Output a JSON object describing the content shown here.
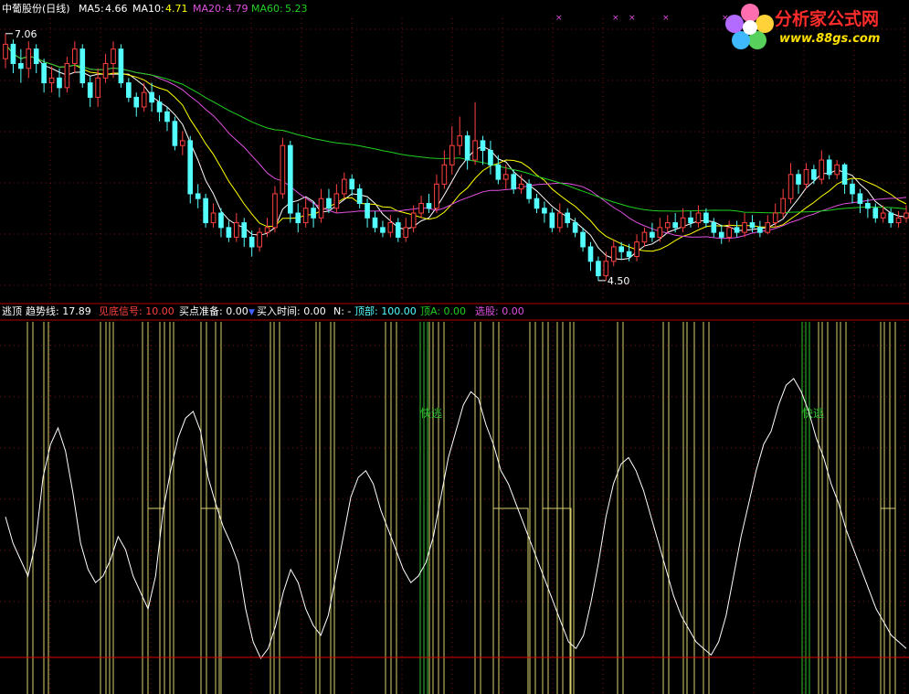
{
  "colors": {
    "background": "#000000",
    "grid": "#7a1010",
    "up": "#ff4040",
    "down": "#54ffff",
    "ma5": "#ffffff",
    "ma10": "#ffff00",
    "ma20": "#e050e0",
    "ma60": "#20d020",
    "trend": "#ffffff",
    "signal_yellow": "#d8d070",
    "signal_green": "#30c030",
    "baseline": "#e00000"
  },
  "header": {
    "stock": "中葡股份(日线)",
    "ma5_label": "MA5:",
    "ma5_value": "4.66",
    "ma10_label": "MA10:",
    "ma10_value": "4.71",
    "ma20_label": "MA20:",
    "ma20_value": "4.79",
    "ma60_label": "MA60:",
    "ma60_value": "5.23"
  },
  "logo": {
    "title": "分析家公式网",
    "url": "www.88gs.com"
  },
  "indicator": {
    "name": "逃顶",
    "items": [
      {
        "label": "趋势线:",
        "value": "17.89",
        "color": "#ffffff"
      },
      {
        "label": "见底信号:",
        "value": "10.00",
        "color": "#ff4040"
      },
      {
        "label": "买点准备:",
        "value": "0.00",
        "color": "#ffffff"
      },
      {
        "label": "买入时间:",
        "value": "0.00",
        "color": "#ffffff"
      },
      {
        "label": "N:",
        "value": "-",
        "color": "#ffffff"
      },
      {
        "label": "顶部:",
        "value": "100.00",
        "color": "#54ffff"
      },
      {
        "label": "顶A:",
        "value": "0.00",
        "color": "#20d020"
      },
      {
        "label": "选股:",
        "value": "0.00",
        "color": "#e050e0"
      }
    ],
    "signal_text": "快逃"
  },
  "chart_data": [
    {
      "type": "candlestick",
      "title": "中葡股份(日线)",
      "high_label": "7.06",
      "low_label": "4.50",
      "ylim": [
        4.3,
        7.2
      ],
      "candles": [
        [
          6.8,
          6.95,
          7.06,
          6.7
        ],
        [
          6.95,
          6.75,
          7.0,
          6.65
        ],
        [
          6.75,
          6.7,
          6.9,
          6.55
        ],
        [
          6.7,
          6.9,
          6.98,
          6.6
        ],
        [
          6.9,
          6.75,
          6.95,
          6.65
        ],
        [
          6.75,
          6.55,
          6.8,
          6.45
        ],
        [
          6.55,
          6.6,
          6.72,
          6.45
        ],
        [
          6.6,
          6.5,
          6.7,
          6.4
        ],
        [
          6.5,
          6.75,
          6.82,
          6.45
        ],
        [
          6.75,
          6.9,
          6.98,
          6.65
        ],
        [
          6.9,
          6.55,
          6.95,
          6.5
        ],
        [
          6.55,
          6.4,
          6.62,
          6.3
        ],
        [
          6.4,
          6.6,
          6.7,
          6.3
        ],
        [
          6.6,
          6.75,
          6.85,
          6.55
        ],
        [
          6.75,
          6.9,
          6.98,
          6.6
        ],
        [
          6.9,
          6.55,
          6.95,
          6.5
        ],
        [
          6.55,
          6.4,
          6.6,
          6.35
        ],
        [
          6.4,
          6.3,
          6.45,
          6.2
        ],
        [
          6.3,
          6.45,
          6.55,
          6.25
        ],
        [
          6.45,
          6.35,
          6.55,
          6.25
        ],
        [
          6.35,
          6.25,
          6.42,
          6.15
        ],
        [
          6.25,
          6.15,
          6.3,
          6.05
        ],
        [
          6.15,
          5.9,
          6.2,
          5.85
        ],
        [
          5.9,
          5.95,
          6.05,
          5.8
        ],
        [
          5.95,
          5.4,
          6.0,
          5.3
        ],
        [
          5.4,
          5.35,
          5.5,
          5.25
        ],
        [
          5.35,
          5.1,
          5.4,
          5.05
        ],
        [
          5.1,
          5.2,
          5.3,
          5.05
        ],
        [
          5.2,
          5.05,
          5.25,
          4.95
        ],
        [
          5.05,
          4.95,
          5.12,
          4.9
        ],
        [
          4.95,
          5.1,
          5.2,
          4.9
        ],
        [
          5.1,
          4.95,
          5.15,
          4.85
        ],
        [
          4.95,
          4.85,
          5.02,
          4.75
        ],
        [
          4.85,
          5.0,
          5.05,
          4.8
        ],
        [
          5.0,
          5.05,
          5.15,
          4.95
        ],
        [
          5.05,
          5.4,
          5.48,
          5.0
        ],
        [
          5.4,
          5.9,
          5.98,
          5.35
        ],
        [
          5.9,
          5.2,
          5.95,
          5.1
        ],
        [
          5.2,
          5.1,
          5.3,
          5.0
        ],
        [
          5.1,
          5.25,
          5.35,
          5.05
        ],
        [
          5.25,
          5.15,
          5.32,
          5.05
        ],
        [
          5.15,
          5.35,
          5.45,
          5.1
        ],
        [
          5.35,
          5.25,
          5.45,
          5.2
        ],
        [
          5.25,
          5.4,
          5.5,
          5.2
        ],
        [
          5.4,
          5.55,
          5.62,
          5.35
        ],
        [
          5.55,
          5.45,
          5.6,
          5.38
        ],
        [
          5.45,
          5.3,
          5.5,
          5.25
        ],
        [
          5.3,
          5.15,
          5.35,
          5.05
        ],
        [
          5.15,
          5.05,
          5.22,
          5.0
        ],
        [
          5.05,
          5.0,
          5.12,
          4.95
        ],
        [
          5.0,
          5.1,
          5.18,
          4.95
        ],
        [
          5.1,
          4.95,
          5.15,
          4.9
        ],
        [
          4.95,
          5.05,
          5.15,
          4.9
        ],
        [
          5.05,
          5.2,
          5.28,
          5.0
        ],
        [
          5.2,
          5.3,
          5.38,
          5.15
        ],
        [
          5.3,
          5.25,
          5.4,
          5.2
        ],
        [
          5.25,
          5.5,
          5.6,
          5.2
        ],
        [
          5.5,
          5.7,
          5.85,
          5.45
        ],
        [
          5.7,
          5.9,
          6.1,
          5.6
        ],
        [
          5.9,
          6.0,
          6.2,
          5.8
        ],
        [
          6.0,
          5.75,
          6.05,
          5.65
        ],
        [
          5.75,
          5.95,
          6.35,
          5.7
        ],
        [
          5.95,
          5.85,
          6.0,
          5.7
        ],
        [
          5.85,
          5.7,
          5.95,
          5.6
        ],
        [
          5.7,
          5.55,
          5.8,
          5.5
        ],
        [
          5.55,
          5.6,
          5.7,
          5.45
        ],
        [
          5.6,
          5.45,
          5.65,
          5.4
        ],
        [
          5.45,
          5.5,
          5.6,
          5.4
        ],
        [
          5.5,
          5.35,
          5.55,
          5.3
        ],
        [
          5.35,
          5.25,
          5.4,
          5.2
        ],
        [
          5.25,
          5.2,
          5.32,
          5.1
        ],
        [
          5.2,
          5.05,
          5.25,
          5.0
        ],
        [
          5.05,
          5.2,
          5.3,
          5.0
        ],
        [
          5.2,
          5.1,
          5.25,
          5.05
        ],
        [
          5.1,
          5.0,
          5.15,
          4.95
        ],
        [
          5.0,
          4.85,
          5.05,
          4.8
        ],
        [
          4.85,
          4.7,
          4.9,
          4.6
        ],
        [
          4.7,
          4.55,
          4.75,
          4.5
        ],
        [
          4.55,
          4.7,
          4.8,
          4.5
        ],
        [
          4.7,
          4.85,
          4.92,
          4.65
        ],
        [
          4.85,
          4.8,
          4.9,
          4.72
        ],
        [
          4.8,
          4.75,
          4.88,
          4.7
        ],
        [
          4.75,
          4.9,
          4.98,
          4.7
        ],
        [
          4.9,
          5.0,
          5.05,
          4.85
        ],
        [
          5.0,
          4.95,
          5.1,
          4.9
        ],
        [
          4.95,
          5.05,
          5.15,
          4.9
        ],
        [
          5.05,
          5.1,
          5.18,
          5.0
        ],
        [
          5.1,
          5.05,
          5.2,
          5.0
        ],
        [
          5.05,
          5.15,
          5.25,
          5.0
        ],
        [
          5.15,
          5.1,
          5.22,
          5.05
        ],
        [
          5.1,
          5.2,
          5.28,
          5.05
        ],
        [
          5.2,
          5.1,
          5.25,
          5.05
        ],
        [
          5.1,
          5.0,
          5.15,
          4.95
        ],
        [
          5.0,
          4.95,
          5.08,
          4.88
        ],
        [
          4.95,
          5.05,
          5.12,
          4.9
        ],
        [
          5.05,
          5.0,
          5.12,
          4.95
        ],
        [
          5.0,
          5.1,
          5.2,
          4.95
        ],
        [
          5.1,
          5.05,
          5.18,
          5.0
        ],
        [
          5.05,
          5.0,
          5.12,
          4.95
        ],
        [
          5.0,
          5.1,
          5.18,
          4.98
        ],
        [
          5.1,
          5.2,
          5.3,
          5.05
        ],
        [
          5.2,
          5.35,
          5.45,
          5.15
        ],
        [
          5.35,
          5.6,
          5.72,
          5.3
        ],
        [
          5.6,
          5.5,
          5.65,
          5.4
        ],
        [
          5.5,
          5.65,
          5.72,
          5.45
        ],
        [
          5.65,
          5.55,
          5.7,
          5.5
        ],
        [
          5.55,
          5.75,
          5.85,
          5.5
        ],
        [
          5.75,
          5.6,
          5.8,
          5.55
        ],
        [
          5.6,
          5.7,
          5.75,
          5.55
        ],
        [
          5.7,
          5.5,
          5.72,
          5.4
        ],
        [
          5.5,
          5.4,
          5.55,
          5.3
        ],
        [
          5.4,
          5.3,
          5.45,
          5.2
        ],
        [
          5.3,
          5.25,
          5.35,
          5.15
        ],
        [
          5.25,
          5.15,
          5.3,
          5.1
        ],
        [
          5.15,
          5.2,
          5.28,
          5.1
        ],
        [
          5.2,
          5.1,
          5.25,
          5.05
        ],
        [
          5.1,
          5.15,
          5.22,
          5.05
        ],
        [
          5.15,
          5.2,
          5.28,
          5.1
        ]
      ],
      "ma_series": [
        {
          "name": "MA5",
          "value": "4.66"
        },
        {
          "name": "MA10",
          "value": "4.71"
        },
        {
          "name": "MA20",
          "value": "4.79"
        },
        {
          "name": "MA60",
          "value": "5.23"
        }
      ]
    },
    {
      "type": "line",
      "title": "逃顶",
      "ylim": [
        -5,
        105
      ],
      "series": [
        {
          "name": "趋势线",
          "values": [
            48,
            40,
            35,
            30,
            40,
            60,
            70,
            75,
            68,
            55,
            40,
            32,
            28,
            30,
            35,
            42,
            38,
            30,
            25,
            20,
            30,
            50,
            62,
            72,
            78,
            80,
            74,
            60,
            52,
            45,
            40,
            34,
            20,
            10,
            5,
            8,
            15,
            25,
            32,
            28,
            20,
            15,
            12,
            18,
            30,
            42,
            54,
            60,
            62,
            58,
            50,
            44,
            38,
            32,
            28,
            30,
            34,
            42,
            54,
            66,
            74,
            82,
            86,
            84,
            76,
            70,
            62,
            58,
            52,
            46,
            40,
            34,
            28,
            22,
            16,
            10,
            8,
            12,
            22,
            34,
            48,
            58,
            64,
            66,
            62,
            56,
            48,
            40,
            32,
            24,
            18,
            14,
            10,
            8,
            6,
            10,
            18,
            30,
            42,
            52,
            62,
            70,
            74,
            82,
            88,
            90,
            86,
            80,
            72,
            66,
            58,
            52,
            44,
            38,
            32,
            26,
            20,
            16,
            12,
            10,
            8
          ]
        }
      ]
    }
  ]
}
